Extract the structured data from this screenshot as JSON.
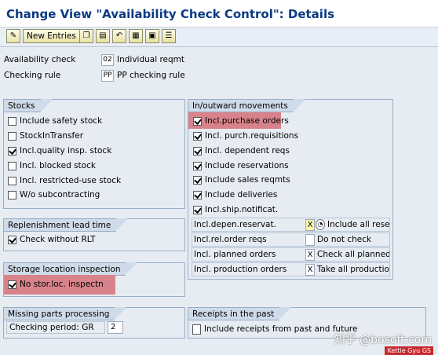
{
  "title": "Change View \"Availability Check Control\": Details",
  "toolbar": {
    "new_entries_label": "New Entries",
    "icons": [
      "edit-icon",
      "copy-icon",
      "delete-icon",
      "undo-icon",
      "select-all-icon",
      "deselect-icon",
      "select-block-icon"
    ]
  },
  "header": {
    "availability_check": {
      "label": "Availability check",
      "code": "02",
      "text": "Individual reqmt"
    },
    "checking_rule": {
      "label": "Checking rule",
      "code": "PP",
      "text": "PP checking rule"
    }
  },
  "stocks": {
    "title": "Stocks",
    "items": [
      {
        "label": "Include safety stock",
        "checked": false
      },
      {
        "label": "StockInTransfer",
        "checked": false
      },
      {
        "label": "Incl.quality insp. stock",
        "checked": true
      },
      {
        "label": "Incl. blocked stock",
        "checked": false
      },
      {
        "label": "Incl. restricted-use stock",
        "checked": false
      },
      {
        "label": "W/o subcontracting",
        "checked": false
      }
    ]
  },
  "replenishment": {
    "title": "Replenishment lead time",
    "item": {
      "label": "Check without RLT",
      "checked": true
    }
  },
  "storage": {
    "title": "Storage location inspection",
    "item": {
      "label": "No stor.loc. inspectn",
      "checked": true
    }
  },
  "missing": {
    "title": "Missing parts processing",
    "label": "Checking period: GR",
    "value": "2"
  },
  "inout": {
    "title": "In/outward movements",
    "items": [
      {
        "label": "Incl.purchase orders",
        "checked": true
      },
      {
        "label": "Incl. purch.requisitions",
        "checked": true
      },
      {
        "label": "Incl. dependent reqs",
        "checked": true
      },
      {
        "label": "Include reservations",
        "checked": true
      },
      {
        "label": "Include sales reqmts",
        "checked": true
      },
      {
        "label": "Include deliveries",
        "checked": true
      },
      {
        "label": "Incl.ship.notificat.",
        "checked": true
      }
    ],
    "grid": [
      {
        "label": "Incl.depen.reservat.",
        "value": "X",
        "desc": "Include all reservatio"
      },
      {
        "label": "Incl.rel.order reqs",
        "value": "",
        "desc": "Do not check"
      },
      {
        "label": "Incl. planned orders",
        "value": "X",
        "desc": "Check all planned or"
      },
      {
        "label": "Incl. production orders",
        "value": "X",
        "desc": "Take all production"
      }
    ]
  },
  "receipts": {
    "title": "Receipts in the past",
    "item": {
      "label": "Include receipts from past and future",
      "checked": false
    }
  },
  "watermark": "知乎 @bosoft.com",
  "stamp": "Kettie Gyu GS"
}
